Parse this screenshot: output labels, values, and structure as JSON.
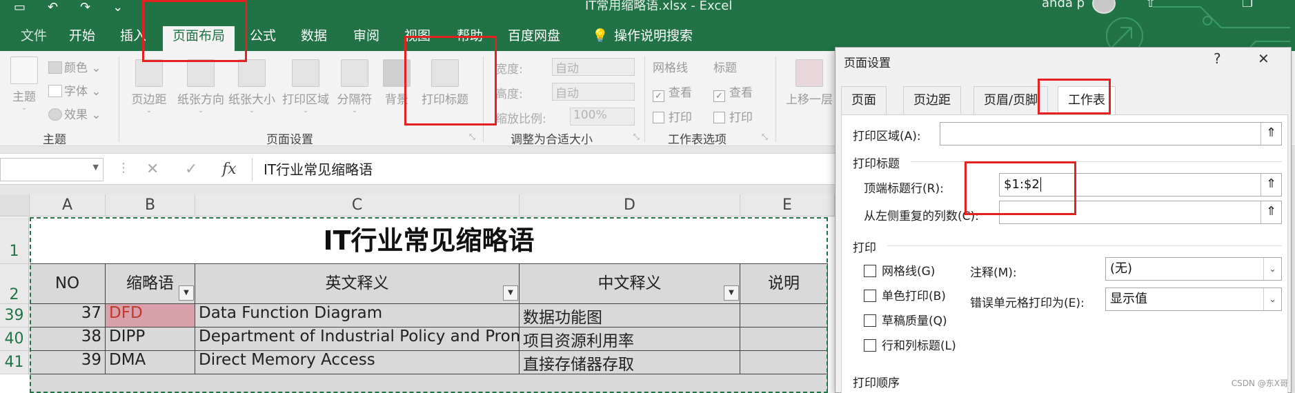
{
  "window": {
    "title": "IT常用缩略语.xlsx - Excel",
    "user": "anda p"
  },
  "ribbon_tabs": [
    "文件",
    "开始",
    "插入",
    "页面布局",
    "公式",
    "数据",
    "审阅",
    "视图",
    "帮助",
    "百度网盘",
    "操作说明搜索"
  ],
  "active_tab": "页面布局",
  "ribbon": {
    "theme_group": {
      "label": "主题",
      "theme_button": "主题",
      "colors": "颜色",
      "fonts": "字体",
      "effects": "效果"
    },
    "page_setup_group": {
      "label": "页面设置",
      "buttons": [
        "页边距",
        "纸张方向",
        "纸张大小",
        "打印区域",
        "分隔符",
        "背景",
        "打印标题"
      ]
    },
    "scale_group": {
      "label": "调整为合适大小",
      "width_label": "宽度:",
      "width_value": "自动",
      "height_label": "高度:",
      "height_value": "自动",
      "scale_label": "缩放比例:",
      "scale_value": "100%"
    },
    "sheet_options_group": {
      "label": "工作表选项",
      "gridlines": "网格线",
      "headings": "标题",
      "view": "查看",
      "print": "打印"
    },
    "arrange_first": "上移一层"
  },
  "formula_bar": {
    "fx": "fx",
    "content": "IT行业常见缩略语"
  },
  "sheet": {
    "columns": [
      "A",
      "B",
      "C",
      "D",
      "E"
    ],
    "title": "IT行业常见缩略语",
    "headers": [
      "NO",
      "缩略语",
      "英文释义",
      "中文释义",
      "说明"
    ],
    "row_numbers": [
      "1",
      "2",
      "39",
      "40",
      "41"
    ],
    "rows": [
      {
        "no": "37",
        "abbr": "DFD",
        "english": "Data Function Diagram",
        "chinese": "数据功能图",
        "note": ""
      },
      {
        "no": "38",
        "abbr": "DIPP",
        "english": "Department of Industrial Policy and Promotion",
        "chinese": "项目资源利用率",
        "note": ""
      },
      {
        "no": "39",
        "abbr": "DMA",
        "english": "Direct Memory Access",
        "chinese": "直接存储器存取",
        "note": ""
      }
    ],
    "highlight_color": "#d8a0a8",
    "highlight_text_color": "#c0392b"
  },
  "dialog": {
    "title": "页面设置",
    "help": "?",
    "close": "✕",
    "tabs": [
      "页面",
      "页边距",
      "页眉/页脚",
      "工作表"
    ],
    "active_tab": "工作表",
    "print_area_label": "打印区域(A):",
    "print_area_value": "",
    "print_titles_section": "打印标题",
    "top_rows_label": "顶端标题行(R):",
    "top_rows_value": "$1:$2",
    "left_cols_label": "从左侧重复的列数(C):",
    "left_cols_value": "",
    "print_section": "打印",
    "gridlines": "网格线(G)",
    "bw": "单色打印(B)",
    "draft": "草稿质量(Q)",
    "row_col_headings": "行和列标题(L)",
    "comments_label": "注释(M):",
    "comments_value": "(无)",
    "errors_label": "错误单元格打印为(E):",
    "errors_value": "显示值",
    "page_order_section": "打印顺序"
  },
  "watermark": "CSDN @东X哥",
  "accent_color": "#217346",
  "annotation_color": "#e62020"
}
